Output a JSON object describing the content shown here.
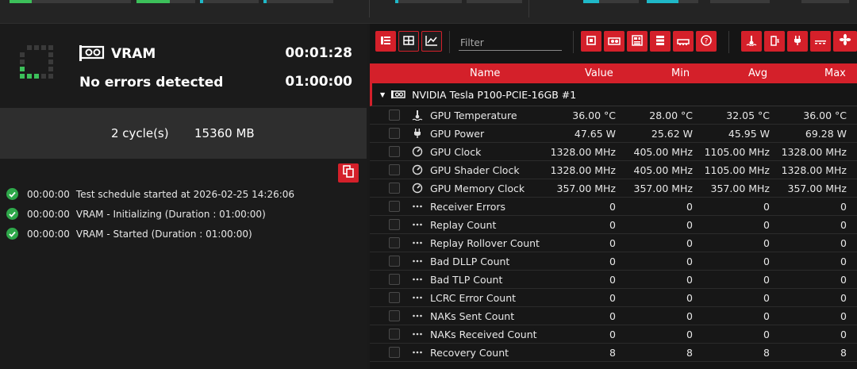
{
  "colors": {
    "accent": "#d4202a",
    "ok": "#2ea84a",
    "activity": "#3cc05a"
  },
  "test": {
    "name": "VRAM",
    "status": "No errors detected",
    "elapsed": "00:01:28",
    "duration": "01:00:00",
    "cycles": "2 cycle(s)",
    "memory": "15360 MB"
  },
  "log": [
    {
      "time": "00:00:00",
      "text": "Test schedule started at 2026-02-25 14:26:06"
    },
    {
      "time": "00:00:00",
      "text": "VRAM - Initializing (Duration : 01:00:00)"
    },
    {
      "time": "00:00:00",
      "text": "VRAM - Started (Duration : 01:00:00)"
    }
  ],
  "toolbar": {
    "filter_placeholder": "Filter",
    "view_buttons": [
      "list-view-icon",
      "table-view-icon",
      "graph-view-icon"
    ],
    "category_buttons": [
      "cpu-icon",
      "gpu-icon",
      "motherboard-icon",
      "storage-icon",
      "memory-icon",
      "help-icon"
    ],
    "sensor_buttons": [
      "temperature-icon",
      "battery-icon",
      "power-plug-icon",
      "voltage-icon",
      "fan-icon"
    ]
  },
  "table": {
    "columns": {
      "name": "Name",
      "value": "Value",
      "min": "Min",
      "avg": "Avg",
      "max": "Max"
    },
    "device": "NVIDIA Tesla P100-PCIE-16GB #1",
    "rows": [
      {
        "icon": "thermometer-icon",
        "name": "GPU Temperature",
        "value": "36.00 °C",
        "min": "28.00 °C",
        "avg": "32.05 °C",
        "max": "36.00 °C"
      },
      {
        "icon": "power-plug-icon",
        "name": "GPU Power",
        "value": "47.65 W",
        "min": "25.62 W",
        "avg": "45.95 W",
        "max": "69.28 W"
      },
      {
        "icon": "gauge-icon",
        "name": "GPU Clock",
        "value": "1328.00 MHz",
        "min": "405.00 MHz",
        "avg": "1105.00 MHz",
        "max": "1328.00 MHz"
      },
      {
        "icon": "gauge-icon",
        "name": "GPU Shader Clock",
        "value": "1328.00 MHz",
        "min": "405.00 MHz",
        "avg": "1105.00 MHz",
        "max": "1328.00 MHz"
      },
      {
        "icon": "gauge-icon",
        "name": "GPU Memory Clock",
        "value": "357.00 MHz",
        "min": "357.00 MHz",
        "avg": "357.00 MHz",
        "max": "357.00 MHz"
      },
      {
        "icon": "dots-icon",
        "name": "Receiver Errors",
        "value": "0",
        "min": "0",
        "avg": "0",
        "max": "0"
      },
      {
        "icon": "dots-icon",
        "name": "Replay Count",
        "value": "0",
        "min": "0",
        "avg": "0",
        "max": "0"
      },
      {
        "icon": "dots-icon",
        "name": "Replay Rollover Count",
        "value": "0",
        "min": "0",
        "avg": "0",
        "max": "0"
      },
      {
        "icon": "dots-icon",
        "name": "Bad DLLP Count",
        "value": "0",
        "min": "0",
        "avg": "0",
        "max": "0"
      },
      {
        "icon": "dots-icon",
        "name": "Bad TLP Count",
        "value": "0",
        "min": "0",
        "avg": "0",
        "max": "0"
      },
      {
        "icon": "dots-icon",
        "name": "LCRC Error Count",
        "value": "0",
        "min": "0",
        "avg": "0",
        "max": "0"
      },
      {
        "icon": "dots-icon",
        "name": "NAKs Sent Count",
        "value": "0",
        "min": "0",
        "avg": "0",
        "max": "0"
      },
      {
        "icon": "dots-icon",
        "name": "NAKs Received Count",
        "value": "0",
        "min": "0",
        "avg": "0",
        "max": "0"
      },
      {
        "icon": "dots-icon",
        "name": "Recovery Count",
        "value": "8",
        "min": "8",
        "avg": "8",
        "max": "8"
      }
    ]
  }
}
